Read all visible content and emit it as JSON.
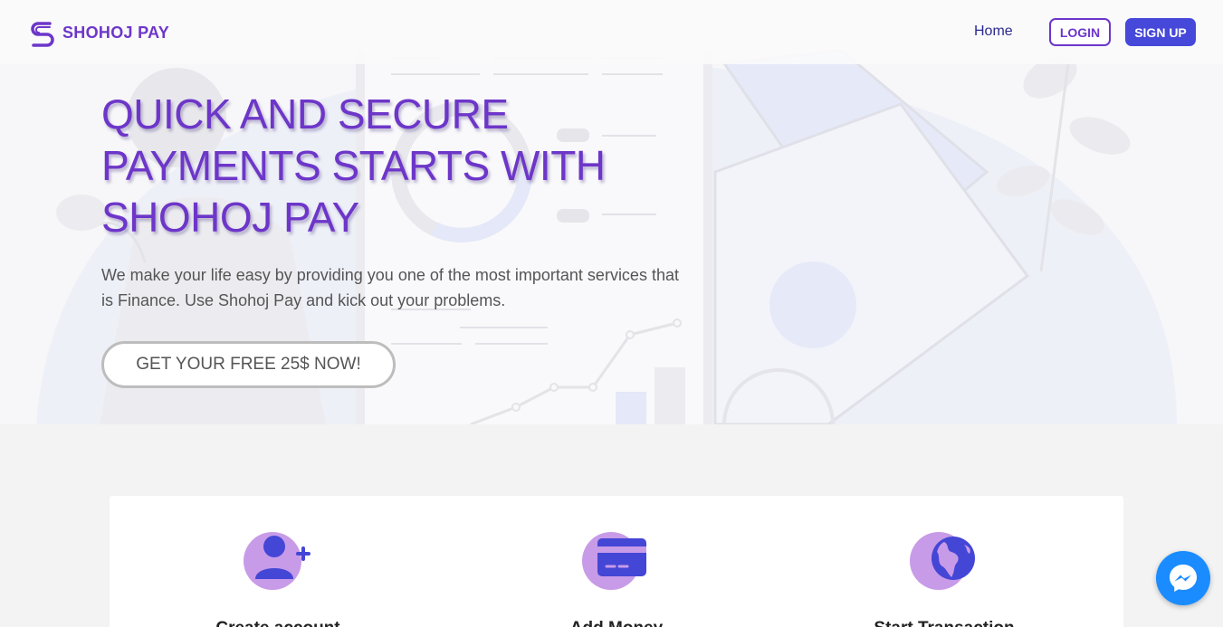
{
  "nav": {
    "brand": "SHOHOJ PAY",
    "home": "Home",
    "login": "LOGIN",
    "signup": "SIGN UP"
  },
  "hero": {
    "title": "QUICK AND SECURE PAYMENTS STARTS WITH SHOHOJ PAY",
    "subtitle": "We make your life easy by providing you one of the most important services that is Finance. Use Shohoj Pay and kick out your problems.",
    "cta": "GET YOUR FREE 25$ NOW!"
  },
  "features": [
    {
      "icon": "add-user-icon",
      "label": "Create account"
    },
    {
      "icon": "credit-card-icon",
      "label": "Add Money"
    },
    {
      "icon": "globe-icon",
      "label": "Start Transaction"
    }
  ],
  "colors": {
    "brand": "#6d36c9",
    "signup_bg": "#4548d8",
    "icon_circle": "#c89be8",
    "icon_glyph": "#4446d6",
    "messenger": "#1a8cff"
  },
  "chat": {
    "icon": "messenger-icon"
  }
}
